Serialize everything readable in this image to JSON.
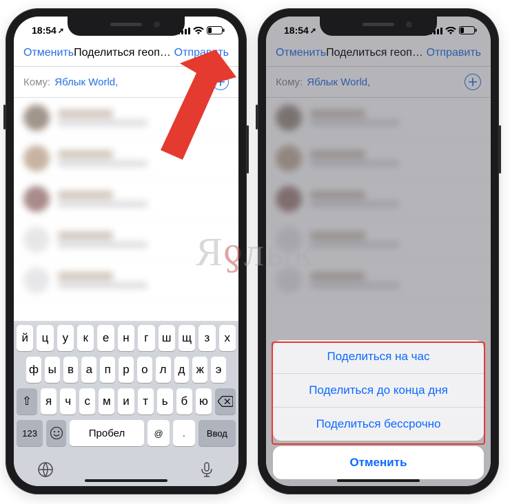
{
  "status": {
    "time": "18:54",
    "arrow_glyph": "➚"
  },
  "nav": {
    "cancel": "Отменить",
    "title": "Поделиться геопози…",
    "send": "Отправить"
  },
  "to": {
    "label": "Кому:",
    "recipient": "Яблык World,"
  },
  "contacts": [
    {
      "avatar_color": "#6f5b4e"
    },
    {
      "avatar_color": "#a98b6f"
    },
    {
      "avatar_color": "#7c4d4a"
    },
    {
      "avatar_color": "#dadade"
    },
    {
      "avatar_color": "#dadade"
    }
  ],
  "keyboard": {
    "row1": [
      "й",
      "ц",
      "у",
      "к",
      "е",
      "н",
      "г",
      "ш",
      "щ",
      "з",
      "х"
    ],
    "row2": [
      "ф",
      "ы",
      "в",
      "а",
      "п",
      "р",
      "о",
      "л",
      "д",
      "ж",
      "э"
    ],
    "row3_mid": [
      "я",
      "ч",
      "с",
      "м",
      "и",
      "т",
      "ь",
      "б",
      "ю"
    ],
    "num_key": "123",
    "space": "Пробел",
    "at": "@",
    "dot": ".",
    "enter": "Ввод",
    "shift_glyph": "⇧"
  },
  "sheet": {
    "options": [
      "Поделиться на час",
      "Поделиться до конца дня",
      "Поделиться бессрочно"
    ],
    "cancel": "Отменить"
  },
  "watermark": {
    "pre": "Я",
    "accent": "ƍ",
    "post": "лык"
  },
  "colors": {
    "ios_blue": "#266ee6",
    "annotation_red": "#e43a2f"
  }
}
